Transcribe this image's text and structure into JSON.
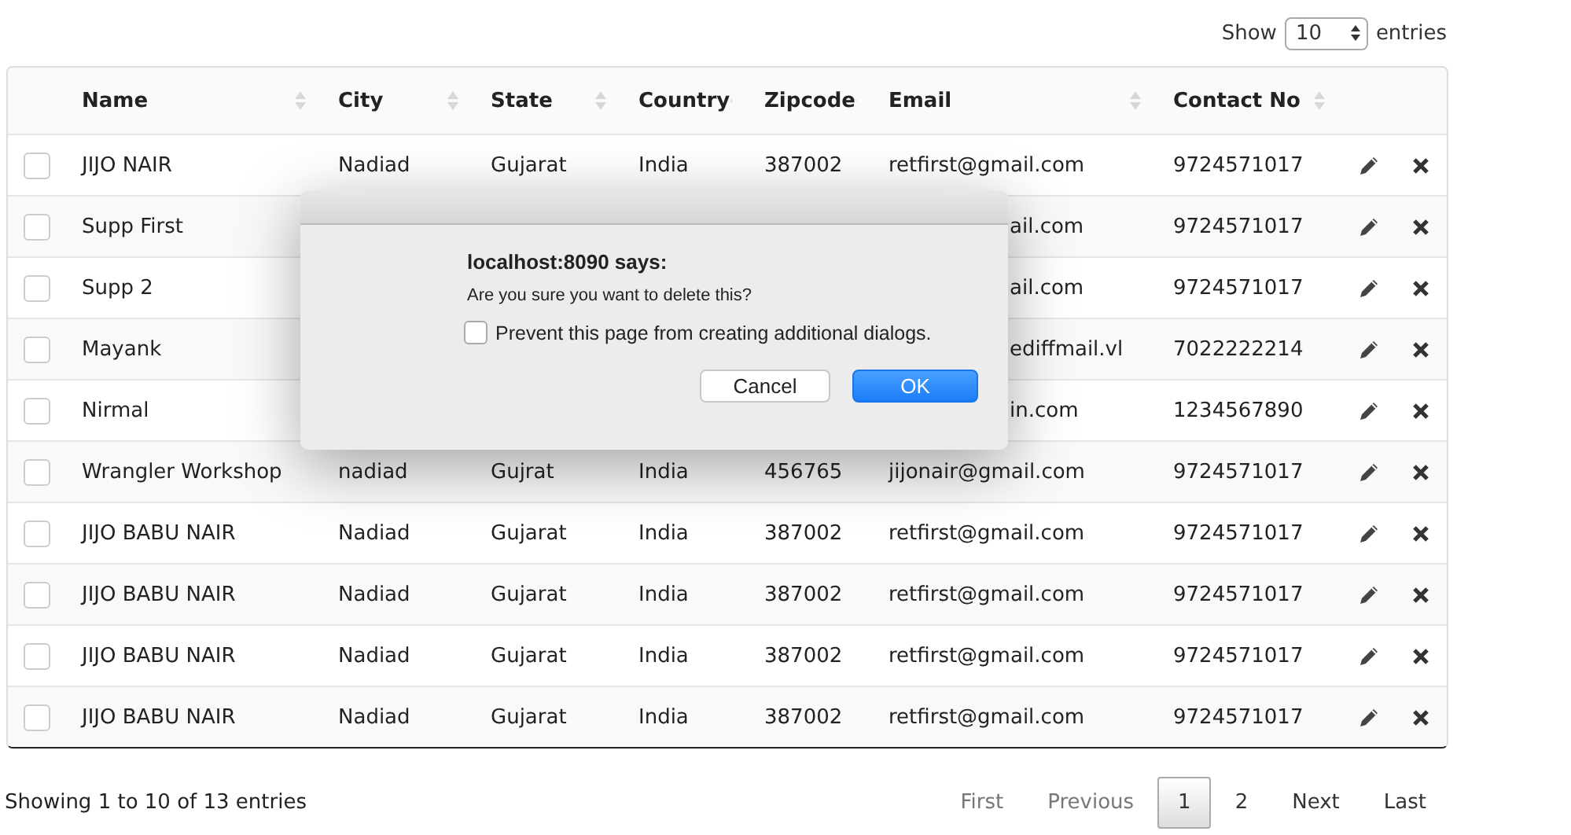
{
  "length_menu": {
    "label_before": "Show",
    "value": "10",
    "label_after": "entries"
  },
  "table": {
    "columns": [
      {
        "label": "Name"
      },
      {
        "label": "City"
      },
      {
        "label": "State"
      },
      {
        "label": "Country"
      },
      {
        "label": "Zipcode"
      },
      {
        "label": "Email"
      },
      {
        "label": "Contact No"
      }
    ],
    "rows": [
      {
        "checked": false,
        "covered": false,
        "name": "JIJO NAIR",
        "city": "Nadiad",
        "state": "Gujarat",
        "country": "India",
        "zipcode": "387002",
        "email": "retfirst@gmail.com",
        "contact": "9724571017"
      },
      {
        "checked": false,
        "covered": true,
        "name": "Supp First",
        "email": "ail.com",
        "contact": "9724571017"
      },
      {
        "checked": false,
        "covered": true,
        "name": "Supp 2",
        "email": "ail.com",
        "contact": "9724571017"
      },
      {
        "checked": false,
        "covered": true,
        "name": "Mayank",
        "email": "ediffmail.vl",
        "contact": "7022222214"
      },
      {
        "checked": false,
        "covered": true,
        "name": "Nirmal",
        "email": "in.com",
        "contact": "1234567890"
      },
      {
        "checked": false,
        "covered": false,
        "name": "Wrangler Workshop",
        "city": "nadiad",
        "state": "Gujrat",
        "country": "India",
        "zipcode": "456765",
        "email": "jijonair@gmail.com",
        "contact": "9724571017"
      },
      {
        "checked": false,
        "covered": false,
        "name": "JIJO BABU NAIR",
        "city": "Nadiad",
        "state": "Gujarat",
        "country": "India",
        "zipcode": "387002",
        "email": "retfirst@gmail.com",
        "contact": "9724571017"
      },
      {
        "checked": false,
        "covered": false,
        "name": "JIJO BABU NAIR",
        "city": "Nadiad",
        "state": "Gujarat",
        "country": "India",
        "zipcode": "387002",
        "email": "retfirst@gmail.com",
        "contact": "9724571017"
      },
      {
        "checked": false,
        "covered": false,
        "name": "JIJO BABU NAIR",
        "city": "Nadiad",
        "state": "Gujarat",
        "country": "India",
        "zipcode": "387002",
        "email": "retfirst@gmail.com",
        "contact": "9724571017"
      },
      {
        "checked": false,
        "covered": false,
        "name": "JIJO BABU NAIR",
        "city": "Nadiad",
        "state": "Gujarat",
        "country": "India",
        "zipcode": "387002",
        "email": "retfirst@gmail.com",
        "contact": "9724571017"
      }
    ]
  },
  "dialog": {
    "title": "localhost:8090 says:",
    "message": "Are you sure you want to delete this?",
    "checkbox": {
      "label": "Prevent this page from creating additional dialogs.",
      "checked": false
    },
    "buttons": [
      {
        "label": "Cancel",
        "kind": "default"
      },
      {
        "label": "OK",
        "kind": "primary"
      }
    ]
  },
  "info": "Showing 1 to 10 of 13 entries",
  "pagination": [
    {
      "label": "First",
      "selected": false,
      "disabled": true
    },
    {
      "label": "Previous",
      "selected": false,
      "disabled": true
    },
    {
      "label": "1",
      "selected": true,
      "disabled": false
    },
    {
      "label": "2",
      "selected": false,
      "disabled": false
    },
    {
      "label": "Next",
      "selected": false,
      "disabled": false
    },
    {
      "label": "Last",
      "selected": false,
      "disabled": false
    }
  ]
}
